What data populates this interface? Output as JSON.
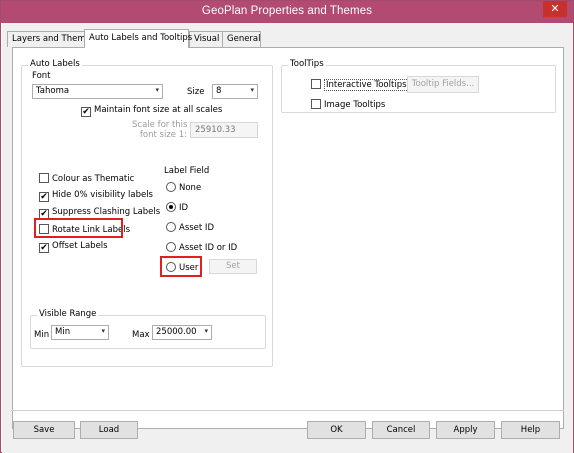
{
  "window": {
    "title": "GeoPlan Properties and Themes",
    "close_glyph": "✕"
  },
  "tabs": [
    {
      "label": "Layers and Themes",
      "active": false
    },
    {
      "label": "Auto Labels and Tooltips",
      "active": true
    },
    {
      "label": "Visual",
      "active": false
    },
    {
      "label": "General",
      "active": false
    }
  ],
  "auto_labels": {
    "group_label": "Auto Labels",
    "font_label": "Font",
    "font_value": "Tahoma",
    "size_label": "Size",
    "size_value": "8",
    "maintain_font_label": "Maintain font size at all scales",
    "maintain_font_checked": true,
    "scale_label_line1": "Scale for this",
    "scale_label_line2": "font size 1:",
    "scale_value": "25910.33",
    "checkboxes": [
      {
        "label": "Colour as Thematic",
        "checked": false
      },
      {
        "label": "Hide 0% visibility labels",
        "checked": true
      },
      {
        "label": "Suppress Clashing Labels",
        "checked": true
      },
      {
        "label": "Rotate Link Labels",
        "checked": false
      },
      {
        "label": "Offset Labels",
        "checked": true
      }
    ],
    "label_field": {
      "group_label": "Label Field",
      "options": [
        {
          "label": "None",
          "selected": false
        },
        {
          "label": "ID",
          "selected": true
        },
        {
          "label": "Asset ID",
          "selected": false
        },
        {
          "label": "Asset ID or ID",
          "selected": false
        },
        {
          "label": "User",
          "selected": false
        }
      ],
      "set_button": "Set"
    },
    "visible_range": {
      "group_label": "Visible Range",
      "min_label": "Min",
      "min_value": "Min",
      "max_label": "Max",
      "max_value": "25000.00"
    }
  },
  "tooltips": {
    "group_label": "ToolTips",
    "interactive_label": "Interactive Tooltips",
    "interactive_checked": false,
    "fields_button": "Tooltip Fields...",
    "image_label": "Image Tooltips",
    "image_checked": false
  },
  "footer": {
    "save": "Save",
    "load": "Load",
    "ok": "OK",
    "cancel": "Cancel",
    "apply": "Apply",
    "help": "Help"
  },
  "colors": {
    "titlebar": "#b24a71",
    "close": "#c7312b",
    "highlight": "#e02020"
  },
  "check_glyph": "✔",
  "dropdown_glyph": "▾"
}
